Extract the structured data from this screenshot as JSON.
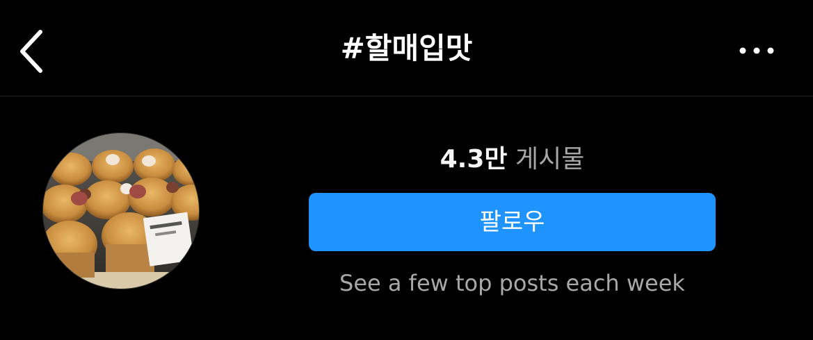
{
  "header": {
    "title": "#할매입맛",
    "back_icon": "chevron-left-icon",
    "more_icon": "more-horizontal-icon"
  },
  "profile": {
    "avatar_alt": "",
    "post_count": "4.3만",
    "post_label": "게시물",
    "follow_label": "팔로우",
    "subtitle": "See a few top posts each week"
  },
  "colors": {
    "background": "#000000",
    "follow_button": "#1f93ff",
    "muted_text": "#a8a8a8",
    "divider": "#262626"
  }
}
